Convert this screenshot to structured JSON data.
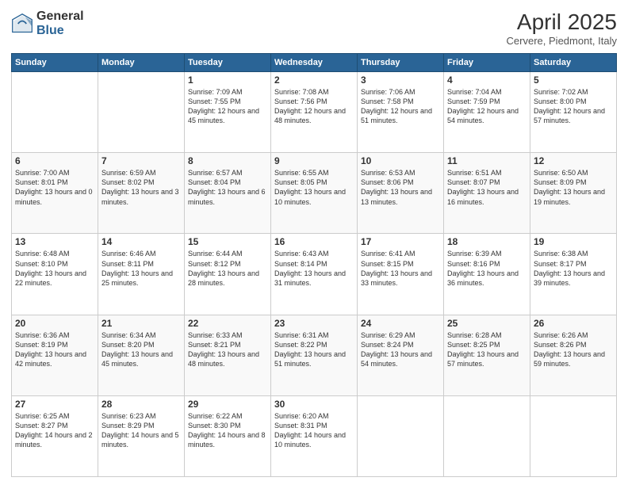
{
  "logo": {
    "general": "General",
    "blue": "Blue"
  },
  "header": {
    "title": "April 2025",
    "subtitle": "Cervere, Piedmont, Italy"
  },
  "weekdays": [
    "Sunday",
    "Monday",
    "Tuesday",
    "Wednesday",
    "Thursday",
    "Friday",
    "Saturday"
  ],
  "weeks": [
    [
      {
        "day": "",
        "sunrise": "",
        "sunset": "",
        "daylight": ""
      },
      {
        "day": "",
        "sunrise": "",
        "sunset": "",
        "daylight": ""
      },
      {
        "day": "1",
        "sunrise": "Sunrise: 7:09 AM",
        "sunset": "Sunset: 7:55 PM",
        "daylight": "Daylight: 12 hours and 45 minutes."
      },
      {
        "day": "2",
        "sunrise": "Sunrise: 7:08 AM",
        "sunset": "Sunset: 7:56 PM",
        "daylight": "Daylight: 12 hours and 48 minutes."
      },
      {
        "day": "3",
        "sunrise": "Sunrise: 7:06 AM",
        "sunset": "Sunset: 7:58 PM",
        "daylight": "Daylight: 12 hours and 51 minutes."
      },
      {
        "day": "4",
        "sunrise": "Sunrise: 7:04 AM",
        "sunset": "Sunset: 7:59 PM",
        "daylight": "Daylight: 12 hours and 54 minutes."
      },
      {
        "day": "5",
        "sunrise": "Sunrise: 7:02 AM",
        "sunset": "Sunset: 8:00 PM",
        "daylight": "Daylight: 12 hours and 57 minutes."
      }
    ],
    [
      {
        "day": "6",
        "sunrise": "Sunrise: 7:00 AM",
        "sunset": "Sunset: 8:01 PM",
        "daylight": "Daylight: 13 hours and 0 minutes."
      },
      {
        "day": "7",
        "sunrise": "Sunrise: 6:59 AM",
        "sunset": "Sunset: 8:02 PM",
        "daylight": "Daylight: 13 hours and 3 minutes."
      },
      {
        "day": "8",
        "sunrise": "Sunrise: 6:57 AM",
        "sunset": "Sunset: 8:04 PM",
        "daylight": "Daylight: 13 hours and 6 minutes."
      },
      {
        "day": "9",
        "sunrise": "Sunrise: 6:55 AM",
        "sunset": "Sunset: 8:05 PM",
        "daylight": "Daylight: 13 hours and 10 minutes."
      },
      {
        "day": "10",
        "sunrise": "Sunrise: 6:53 AM",
        "sunset": "Sunset: 8:06 PM",
        "daylight": "Daylight: 13 hours and 13 minutes."
      },
      {
        "day": "11",
        "sunrise": "Sunrise: 6:51 AM",
        "sunset": "Sunset: 8:07 PM",
        "daylight": "Daylight: 13 hours and 16 minutes."
      },
      {
        "day": "12",
        "sunrise": "Sunrise: 6:50 AM",
        "sunset": "Sunset: 8:09 PM",
        "daylight": "Daylight: 13 hours and 19 minutes."
      }
    ],
    [
      {
        "day": "13",
        "sunrise": "Sunrise: 6:48 AM",
        "sunset": "Sunset: 8:10 PM",
        "daylight": "Daylight: 13 hours and 22 minutes."
      },
      {
        "day": "14",
        "sunrise": "Sunrise: 6:46 AM",
        "sunset": "Sunset: 8:11 PM",
        "daylight": "Daylight: 13 hours and 25 minutes."
      },
      {
        "day": "15",
        "sunrise": "Sunrise: 6:44 AM",
        "sunset": "Sunset: 8:12 PM",
        "daylight": "Daylight: 13 hours and 28 minutes."
      },
      {
        "day": "16",
        "sunrise": "Sunrise: 6:43 AM",
        "sunset": "Sunset: 8:14 PM",
        "daylight": "Daylight: 13 hours and 31 minutes."
      },
      {
        "day": "17",
        "sunrise": "Sunrise: 6:41 AM",
        "sunset": "Sunset: 8:15 PM",
        "daylight": "Daylight: 13 hours and 33 minutes."
      },
      {
        "day": "18",
        "sunrise": "Sunrise: 6:39 AM",
        "sunset": "Sunset: 8:16 PM",
        "daylight": "Daylight: 13 hours and 36 minutes."
      },
      {
        "day": "19",
        "sunrise": "Sunrise: 6:38 AM",
        "sunset": "Sunset: 8:17 PM",
        "daylight": "Daylight: 13 hours and 39 minutes."
      }
    ],
    [
      {
        "day": "20",
        "sunrise": "Sunrise: 6:36 AM",
        "sunset": "Sunset: 8:19 PM",
        "daylight": "Daylight: 13 hours and 42 minutes."
      },
      {
        "day": "21",
        "sunrise": "Sunrise: 6:34 AM",
        "sunset": "Sunset: 8:20 PM",
        "daylight": "Daylight: 13 hours and 45 minutes."
      },
      {
        "day": "22",
        "sunrise": "Sunrise: 6:33 AM",
        "sunset": "Sunset: 8:21 PM",
        "daylight": "Daylight: 13 hours and 48 minutes."
      },
      {
        "day": "23",
        "sunrise": "Sunrise: 6:31 AM",
        "sunset": "Sunset: 8:22 PM",
        "daylight": "Daylight: 13 hours and 51 minutes."
      },
      {
        "day": "24",
        "sunrise": "Sunrise: 6:29 AM",
        "sunset": "Sunset: 8:24 PM",
        "daylight": "Daylight: 13 hours and 54 minutes."
      },
      {
        "day": "25",
        "sunrise": "Sunrise: 6:28 AM",
        "sunset": "Sunset: 8:25 PM",
        "daylight": "Daylight: 13 hours and 57 minutes."
      },
      {
        "day": "26",
        "sunrise": "Sunrise: 6:26 AM",
        "sunset": "Sunset: 8:26 PM",
        "daylight": "Daylight: 13 hours and 59 minutes."
      }
    ],
    [
      {
        "day": "27",
        "sunrise": "Sunrise: 6:25 AM",
        "sunset": "Sunset: 8:27 PM",
        "daylight": "Daylight: 14 hours and 2 minutes."
      },
      {
        "day": "28",
        "sunrise": "Sunrise: 6:23 AM",
        "sunset": "Sunset: 8:29 PM",
        "daylight": "Daylight: 14 hours and 5 minutes."
      },
      {
        "day": "29",
        "sunrise": "Sunrise: 6:22 AM",
        "sunset": "Sunset: 8:30 PM",
        "daylight": "Daylight: 14 hours and 8 minutes."
      },
      {
        "day": "30",
        "sunrise": "Sunrise: 6:20 AM",
        "sunset": "Sunset: 8:31 PM",
        "daylight": "Daylight: 14 hours and 10 minutes."
      },
      {
        "day": "",
        "sunrise": "",
        "sunset": "",
        "daylight": ""
      },
      {
        "day": "",
        "sunrise": "",
        "sunset": "",
        "daylight": ""
      },
      {
        "day": "",
        "sunrise": "",
        "sunset": "",
        "daylight": ""
      }
    ]
  ]
}
